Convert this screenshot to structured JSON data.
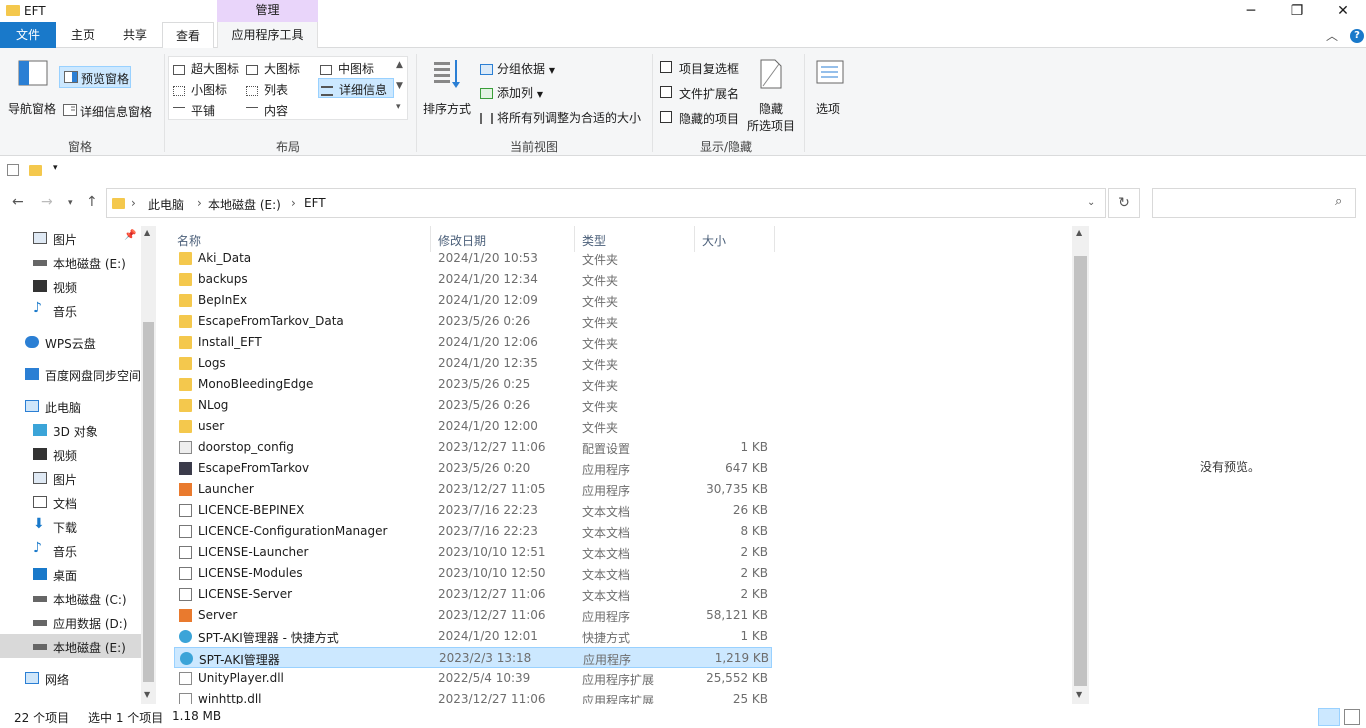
{
  "window": {
    "title": "EFT",
    "minimize": "─",
    "maximize": "❐",
    "close": "✕"
  },
  "ribbon_tabs": {
    "file": "文件",
    "home": "主页",
    "share": "共享",
    "view": "查看",
    "manage_header": "管理",
    "app_tools": "应用程序工具"
  },
  "ribbon": {
    "pane_group": {
      "nav_pane": "导航窗格",
      "preview_pane": "预览窗格",
      "details_pane": "详细信息窗格",
      "label": "窗格"
    },
    "layout_group": {
      "extra_large": "超大图标",
      "large": "大图标",
      "medium": "中图标",
      "small": "小图标",
      "list": "列表",
      "details": "详细信息",
      "tiles": "平铺",
      "content": "内容",
      "label": "布局"
    },
    "view_group": {
      "sort_by": "排序方式",
      "group_by": "分组依据",
      "add_columns": "添加列",
      "fit_columns": "将所有列调整为合适的大小",
      "label": "当前视图"
    },
    "show_group": {
      "item_checkboxes": "项目复选框",
      "file_extensions": "文件扩展名",
      "hidden_items": "隐藏的项目",
      "hide_selected_line1": "隐藏",
      "hide_selected_line2": "所选项目",
      "label": "显示/隐藏"
    },
    "options": "选项"
  },
  "address": {
    "segments": [
      "此电脑",
      "本地磁盘 (E:)",
      "EFT"
    ]
  },
  "nav": {
    "quick": [
      {
        "label": "图片"
      },
      {
        "label": "本地磁盘 (E:)"
      },
      {
        "label": "视频"
      },
      {
        "label": "音乐"
      }
    ],
    "wps": "WPS云盘",
    "baidu": "百度网盘同步空间",
    "pc": "此电脑",
    "pc_items": [
      {
        "label": "3D 对象"
      },
      {
        "label": "视频"
      },
      {
        "label": "图片"
      },
      {
        "label": "文档"
      },
      {
        "label": "下载"
      },
      {
        "label": "音乐"
      },
      {
        "label": "桌面"
      },
      {
        "label": "本地磁盘 (C:)"
      },
      {
        "label": "应用数据 (D:)"
      },
      {
        "label": "本地磁盘 (E:)"
      }
    ],
    "network": "网络"
  },
  "columns": {
    "name": "名称",
    "date": "修改日期",
    "type": "类型",
    "size": "大小"
  },
  "files": [
    {
      "name": "Aki_Data",
      "date": "2024/1/20 10:53",
      "type": "文件夹",
      "size": "",
      "icon": "folder"
    },
    {
      "name": "backups",
      "date": "2024/1/20 12:34",
      "type": "文件夹",
      "size": "",
      "icon": "folder"
    },
    {
      "name": "BepInEx",
      "date": "2024/1/20 12:09",
      "type": "文件夹",
      "size": "",
      "icon": "folder"
    },
    {
      "name": "EscapeFromTarkov_Data",
      "date": "2023/5/26 0:26",
      "type": "文件夹",
      "size": "",
      "icon": "folder"
    },
    {
      "name": "Install_EFT",
      "date": "2024/1/20 12:06",
      "type": "文件夹",
      "size": "",
      "icon": "folder"
    },
    {
      "name": "Logs",
      "date": "2024/1/20 12:35",
      "type": "文件夹",
      "size": "",
      "icon": "folder"
    },
    {
      "name": "MonoBleedingEdge",
      "date": "2023/5/26 0:25",
      "type": "文件夹",
      "size": "",
      "icon": "folder"
    },
    {
      "name": "NLog",
      "date": "2023/5/26 0:26",
      "type": "文件夹",
      "size": "",
      "icon": "folder"
    },
    {
      "name": "user",
      "date": "2024/1/20 12:00",
      "type": "文件夹",
      "size": "",
      "icon": "folder"
    },
    {
      "name": "doorstop_config",
      "date": "2023/12/27 11:06",
      "type": "配置设置",
      "size": "1 KB",
      "icon": "cfg"
    },
    {
      "name": "EscapeFromTarkov",
      "date": "2023/5/26 0:20",
      "type": "应用程序",
      "size": "647 KB",
      "icon": "eft"
    },
    {
      "name": "Launcher",
      "date": "2023/12/27 11:05",
      "type": "应用程序",
      "size": "30,735 KB",
      "icon": "app"
    },
    {
      "name": "LICENCE-BEPINEX",
      "date": "2023/7/16 22:23",
      "type": "文本文档",
      "size": "26 KB",
      "icon": "doc"
    },
    {
      "name": "LICENCE-ConfigurationManager",
      "date": "2023/7/16 22:23",
      "type": "文本文档",
      "size": "8 KB",
      "icon": "doc"
    },
    {
      "name": "LICENSE-Launcher",
      "date": "2023/10/10 12:51",
      "type": "文本文档",
      "size": "2 KB",
      "icon": "doc"
    },
    {
      "name": "LICENSE-Modules",
      "date": "2023/10/10 12:50",
      "type": "文本文档",
      "size": "2 KB",
      "icon": "doc"
    },
    {
      "name": "LICENSE-Server",
      "date": "2023/12/27 11:06",
      "type": "文本文档",
      "size": "2 KB",
      "icon": "doc"
    },
    {
      "name": "Server",
      "date": "2023/12/27 11:06",
      "type": "应用程序",
      "size": "58,121 KB",
      "icon": "app"
    },
    {
      "name": "SPT-AKI管理器 - 快捷方式",
      "date": "2024/1/20 12:01",
      "type": "快捷方式",
      "size": "1 KB",
      "icon": "spt"
    },
    {
      "name": "SPT-AKI管理器",
      "date": "2023/2/3 13:18",
      "type": "应用程序",
      "size": "1,219 KB",
      "icon": "spt",
      "selected": true
    },
    {
      "name": "UnityPlayer.dll",
      "date": "2022/5/4 10:39",
      "type": "应用程序扩展",
      "size": "25,552 KB",
      "icon": "dll"
    },
    {
      "name": "winhttp.dll",
      "date": "2023/12/27 11:06",
      "type": "应用程序扩展",
      "size": "25 KB",
      "icon": "dll"
    }
  ],
  "preview": {
    "empty": "没有预览。"
  },
  "status": {
    "count": "22 个项目",
    "selected": "选中 1 个项目",
    "size": "1.18 MB"
  }
}
